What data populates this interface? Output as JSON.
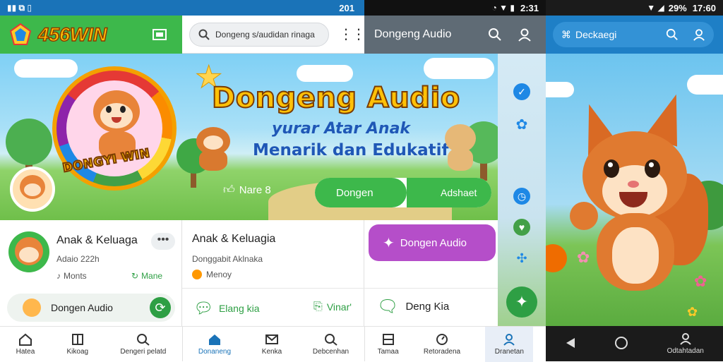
{
  "status": {
    "left_time": "201",
    "mid_time": "2:31",
    "right_battery": "29%",
    "right_time": "17:60"
  },
  "app": {
    "logo_text": "456WIN",
    "search_text": "Dongeng s/audidan rinaga"
  },
  "panel3_header": {
    "title": "Dongeng Audio"
  },
  "panel4_header": {
    "search_text": "Deckaegi"
  },
  "banner": {
    "title": "Dongeng Audio",
    "subtitle1": "yurar Atar Anak",
    "subtitle2": "Menarik dan Edukatif",
    "badge_text": "DONGYI WIN",
    "likes": "Nare 8",
    "btn_left": "Dongen",
    "btn_right": "Adshaet"
  },
  "card1": {
    "title": "Anak & Keluaga",
    "meta": "Adaio 222h",
    "stat": "Monts",
    "link": "Mane",
    "footer_label": "Dongen Audio"
  },
  "card2": {
    "title": "Anak & Keluagia",
    "meta": "Donggabit Aklnaka",
    "stat": "Menoy",
    "action1": "Elang kia",
    "action2": "Vinar'"
  },
  "card3": {
    "button": "Dongen Audio",
    "item": "Deng Kia"
  },
  "nav1": [
    {
      "label": "Hatea",
      "icon": "home-icon"
    },
    {
      "label": "Kikoag",
      "icon": "book-icon"
    },
    {
      "label": "Dengeri pelatd",
      "icon": "search-icon"
    }
  ],
  "nav2": [
    {
      "label": "Donaneng",
      "icon": "home-icon"
    },
    {
      "label": "Kenka",
      "icon": "mail-icon"
    },
    {
      "label": "Debcenhan",
      "icon": "search-icon"
    }
  ],
  "nav3": [
    {
      "label": "Tamaa",
      "icon": "book-icon"
    },
    {
      "label": "Retoradena",
      "icon": "timer-icon"
    },
    {
      "label": "Dranetan",
      "icon": "user-icon"
    }
  ],
  "nav4": [
    {
      "label": "back",
      "icon": "back-icon"
    },
    {
      "label": "home",
      "icon": "circle-home-icon"
    },
    {
      "label": "Odtahtadan",
      "icon": "user-icon"
    }
  ],
  "colors": {
    "brand_green": "#3db84b",
    "accent_blue": "#1a73b8",
    "purple": "#b54ec9",
    "title_yellow": "#ffc107"
  }
}
